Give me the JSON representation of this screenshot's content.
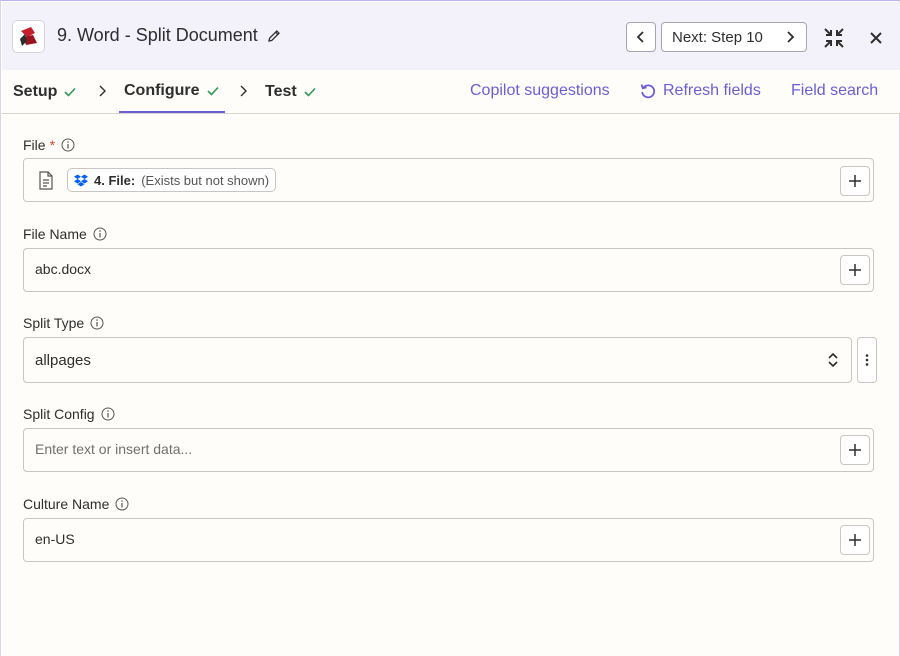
{
  "header": {
    "app_icon": "word-app-logo-icon",
    "title": "9. Word - Split Document",
    "prev_icon": "chevron-left-icon",
    "next_label": "Next: Step 10",
    "next_icon": "chevron-right-icon",
    "collapse_icon": "collapse-arrows-icon",
    "close_icon": "close-icon"
  },
  "tabs": [
    {
      "label": "Setup",
      "status": "complete"
    },
    {
      "label": "Configure",
      "status": "complete",
      "active": true
    },
    {
      "label": "Test",
      "status": "complete"
    }
  ],
  "actions": {
    "copilot": "Copilot suggestions",
    "refresh": "Refresh fields",
    "field_search": "Field search"
  },
  "fields": {
    "file": {
      "label": "File",
      "required_marker": "*",
      "chip_strong": "4. File:",
      "chip_muted": "(Exists but not shown)"
    },
    "file_name": {
      "label": "File Name",
      "value": "abc.docx"
    },
    "split_type": {
      "label": "Split Type",
      "value": "allpages"
    },
    "split_config": {
      "label": "Split Config",
      "placeholder": "Enter text or insert data..."
    },
    "culture_name": {
      "label": "Culture Name",
      "value": "en-US"
    }
  },
  "colors": {
    "accent": "#6a5ed8",
    "check": "#2e9a55",
    "required": "#d9452b",
    "header_bg": "#f3f2fa"
  }
}
